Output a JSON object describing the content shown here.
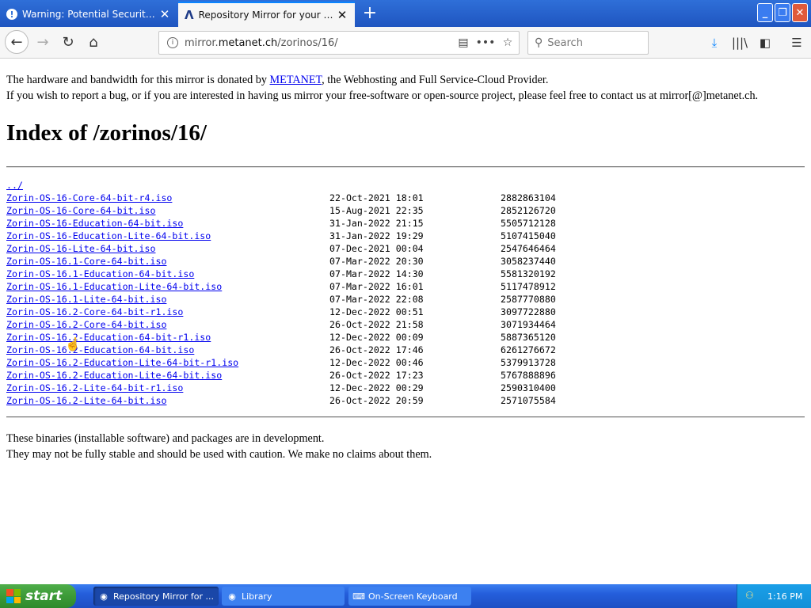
{
  "browser": {
    "tabs": [
      {
        "label": "Warning: Potential Security Risk Ahead",
        "icon": "warning-icon"
      },
      {
        "label": "Repository Mirror for your Cloud Server",
        "icon": "site-favicon"
      }
    ],
    "new_tab_symbol": "+",
    "url": {
      "prefix": "mirror.",
      "domain": "metanet.ch",
      "path": "/zorinos/16/"
    },
    "search_placeholder": "Search"
  },
  "page": {
    "intro_line1_before": "The hardware and bandwidth for this mirror is donated by ",
    "intro_link": "METANET",
    "intro_line1_after": ", the Webhosting and Full Service-Cloud Provider.",
    "intro_line2": "If you wish to report a bug, or if you are interested in having us mirror your free-software or open-source project, please feel free to contact us at mirror[@]metanet.ch.",
    "heading": "Index of /zorinos/16/",
    "parent_link": "../",
    "files": [
      {
        "name": "Zorin-OS-16-Core-64-bit-r4.iso",
        "date": "22-Oct-2021 18:01",
        "size": "2882863104"
      },
      {
        "name": "Zorin-OS-16-Core-64-bit.iso",
        "date": "15-Aug-2021 22:35",
        "size": "2852126720"
      },
      {
        "name": "Zorin-OS-16-Education-64-bit.iso",
        "date": "31-Jan-2022 21:15",
        "size": "5505712128"
      },
      {
        "name": "Zorin-OS-16-Education-Lite-64-bit.iso",
        "date": "31-Jan-2022 19:29",
        "size": "5107415040"
      },
      {
        "name": "Zorin-OS-16-Lite-64-bit.iso",
        "date": "07-Dec-2021 00:04",
        "size": "2547646464"
      },
      {
        "name": "Zorin-OS-16.1-Core-64-bit.iso",
        "date": "07-Mar-2022 20:30",
        "size": "3058237440"
      },
      {
        "name": "Zorin-OS-16.1-Education-64-bit.iso",
        "date": "07-Mar-2022 14:30",
        "size": "5581320192"
      },
      {
        "name": "Zorin-OS-16.1-Education-Lite-64-bit.iso",
        "date": "07-Mar-2022 16:01",
        "size": "5117478912"
      },
      {
        "name": "Zorin-OS-16.1-Lite-64-bit.iso",
        "date": "07-Mar-2022 22:08",
        "size": "2587770880"
      },
      {
        "name": "Zorin-OS-16.2-Core-64-bit-r1.iso",
        "date": "12-Dec-2022 00:51",
        "size": "3097722880"
      },
      {
        "name": "Zorin-OS-16.2-Core-64-bit.iso",
        "date": "26-Oct-2022 21:58",
        "size": "3071934464"
      },
      {
        "name": "Zorin-OS-16.2-Education-64-bit-r1.iso",
        "date": "12-Dec-2022 00:09",
        "size": "5887365120"
      },
      {
        "name": "Zorin-OS-16.2-Education-64-bit.iso",
        "date": "26-Oct-2022 17:46",
        "size": "6261276672"
      },
      {
        "name": "Zorin-OS-16.2-Education-Lite-64-bit-r1.iso",
        "date": "12-Dec-2022 00:46",
        "size": "5379913728"
      },
      {
        "name": "Zorin-OS-16.2-Education-Lite-64-bit.iso",
        "date": "26-Oct-2022 17:23",
        "size": "5767888896"
      },
      {
        "name": "Zorin-OS-16.2-Lite-64-bit-r1.iso",
        "date": "12-Dec-2022 00:29",
        "size": "2590310400"
      },
      {
        "name": "Zorin-OS-16.2-Lite-64-bit.iso",
        "date": "26-Oct-2022 20:59",
        "size": "2571075584"
      }
    ],
    "outro_line1": "These binaries (installable software) and packages are in development.",
    "outro_line2": "They may not be fully stable and should be used with caution. We make no claims about them."
  },
  "taskbar": {
    "start_label": "start",
    "tasks": [
      {
        "label": "Repository Mirror for ...",
        "icon": "firefox-icon"
      },
      {
        "label": "Library",
        "icon": "library-icon"
      },
      {
        "label": "On-Screen Keyboard",
        "icon": "keyboard-icon"
      }
    ],
    "clock": "1:16 PM"
  },
  "colors": {
    "link": "#0000ee",
    "taskbar": "#245edb",
    "start_button": "#3c9a37"
  }
}
